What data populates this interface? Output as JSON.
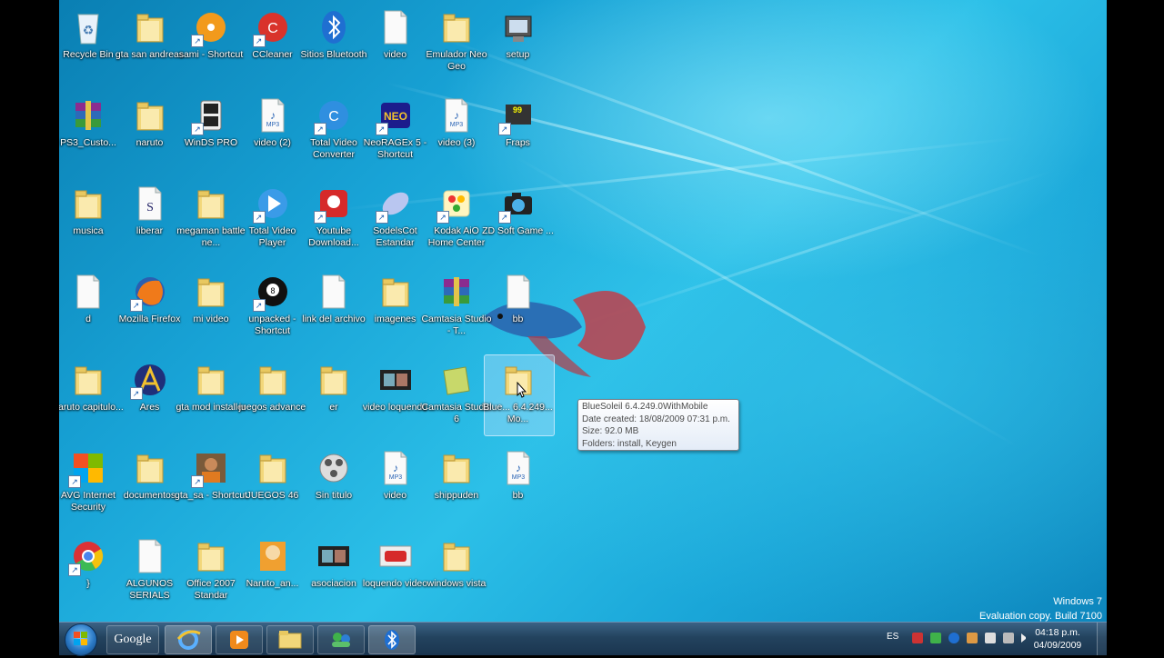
{
  "desktop": {
    "icons": [
      {
        "label": "Recycle Bin",
        "kind": "recycle"
      },
      {
        "label": "gta san andreas",
        "kind": "folder"
      },
      {
        "label": "sami - Shortcut",
        "kind": "disc",
        "shortcut": true
      },
      {
        "label": "CCleaner",
        "kind": "ccleaner",
        "shortcut": true
      },
      {
        "label": "Sitios Bluetooth",
        "kind": "bluetooth"
      },
      {
        "label": "video",
        "kind": "file"
      },
      {
        "label": "Emulador Neo Geo",
        "kind": "folder"
      },
      {
        "label": "setup",
        "kind": "setup"
      },
      {
        "label": "PS3_Custo...",
        "kind": "rar"
      },
      {
        "label": "naruto",
        "kind": "folder"
      },
      {
        "label": "WinDS PRO",
        "kind": "ds",
        "shortcut": true
      },
      {
        "label": "video (2)",
        "kind": "mp3"
      },
      {
        "label": "Total Video Converter",
        "kind": "tvc",
        "shortcut": true
      },
      {
        "label": "NeoRAGEx 5 - Shortcut",
        "kind": "neo",
        "shortcut": true
      },
      {
        "label": "video (3)",
        "kind": "mp3"
      },
      {
        "label": "Fraps",
        "kind": "fraps",
        "shortcut": true
      },
      {
        "label": "musica",
        "kind": "folder"
      },
      {
        "label": "liberar",
        "kind": "script"
      },
      {
        "label": "megaman battle ne...",
        "kind": "folder"
      },
      {
        "label": "Total Video Player",
        "kind": "play",
        "shortcut": true
      },
      {
        "label": "Youtube Download...",
        "kind": "youtube",
        "shortcut": true
      },
      {
        "label": "SodelsCot Estandar",
        "kind": "sodel",
        "shortcut": true
      },
      {
        "label": "Kodak AiO Home Center",
        "kind": "kodak",
        "shortcut": true
      },
      {
        "label": "ZD Soft Game ...",
        "kind": "camera",
        "shortcut": true
      },
      {
        "label": "d",
        "kind": "file"
      },
      {
        "label": "Mozilla Firefox",
        "kind": "firefox",
        "shortcut": true
      },
      {
        "label": "mi video",
        "kind": "folder"
      },
      {
        "label": "unpacked - Shortcut",
        "kind": "ball",
        "shortcut": true
      },
      {
        "label": "link del archivo",
        "kind": "file"
      },
      {
        "label": "imagenes",
        "kind": "folder"
      },
      {
        "label": "Camtasia Studio - T...",
        "kind": "rar"
      },
      {
        "label": "bb",
        "kind": "file"
      },
      {
        "label": "naruto capitulo...",
        "kind": "folder"
      },
      {
        "label": "Ares",
        "kind": "ares",
        "shortcut": true
      },
      {
        "label": "gta mod installer",
        "kind": "folder"
      },
      {
        "label": "juegos advance",
        "kind": "folder"
      },
      {
        "label": "er",
        "kind": "folder"
      },
      {
        "label": "video loquendo",
        "kind": "video"
      },
      {
        "label": "Camtasia Studio 6",
        "kind": "camtasia"
      },
      {
        "label": "BlueSoleil 6.4.249.0WithMobile",
        "kind": "folder",
        "selected": true,
        "display": "Blue... 6.4.249... Mo..."
      },
      {
        "label": "AVG Internet Security",
        "kind": "avg",
        "shortcut": true
      },
      {
        "label": "documentos",
        "kind": "folder"
      },
      {
        "label": "gta_sa - Shortcut",
        "kind": "gta",
        "shortcut": true
      },
      {
        "label": "JUEGOS 46",
        "kind": "folder"
      },
      {
        "label": "Sin titulo",
        "kind": "media"
      },
      {
        "label": "video",
        "kind": "mp3"
      },
      {
        "label": "shippuden",
        "kind": "folder"
      },
      {
        "label": "bb",
        "kind": "mp3"
      },
      {
        "label": "}",
        "kind": "chrome",
        "shortcut": true
      },
      {
        "label": "ALGUNOS SERIALS",
        "kind": "file"
      },
      {
        "label": "Office 2007 Standar",
        "kind": "folder"
      },
      {
        "label": "Naruto_an...",
        "kind": "naruto"
      },
      {
        "label": "asociacion",
        "kind": "video"
      },
      {
        "label": "loquendo video",
        "kind": "youtubevid"
      },
      {
        "label": "windows vista",
        "kind": "folder"
      }
    ]
  },
  "tooltip": {
    "lines": [
      "BlueSoleil 6.4.249.0WithMobile",
      "Date created: 18/08/2009 07:31 p.m.",
      "Size: 92.0 MB",
      "Folders: install, Keygen"
    ]
  },
  "watermark": {
    "line1": "Windows 7",
    "line2": "Evaluation copy. Build 7100"
  },
  "taskbar": {
    "search_label": "Google",
    "items": [
      "internet-explorer",
      "media-player",
      "windows-explorer",
      "messenger",
      "bluetooth"
    ],
    "language": "ES",
    "time": "04:18 p.m.",
    "date": "04/09/2009"
  },
  "colors": {
    "folder": "#f2d77a",
    "taskbar": "#23435e",
    "accent": "#2cc0e8"
  }
}
